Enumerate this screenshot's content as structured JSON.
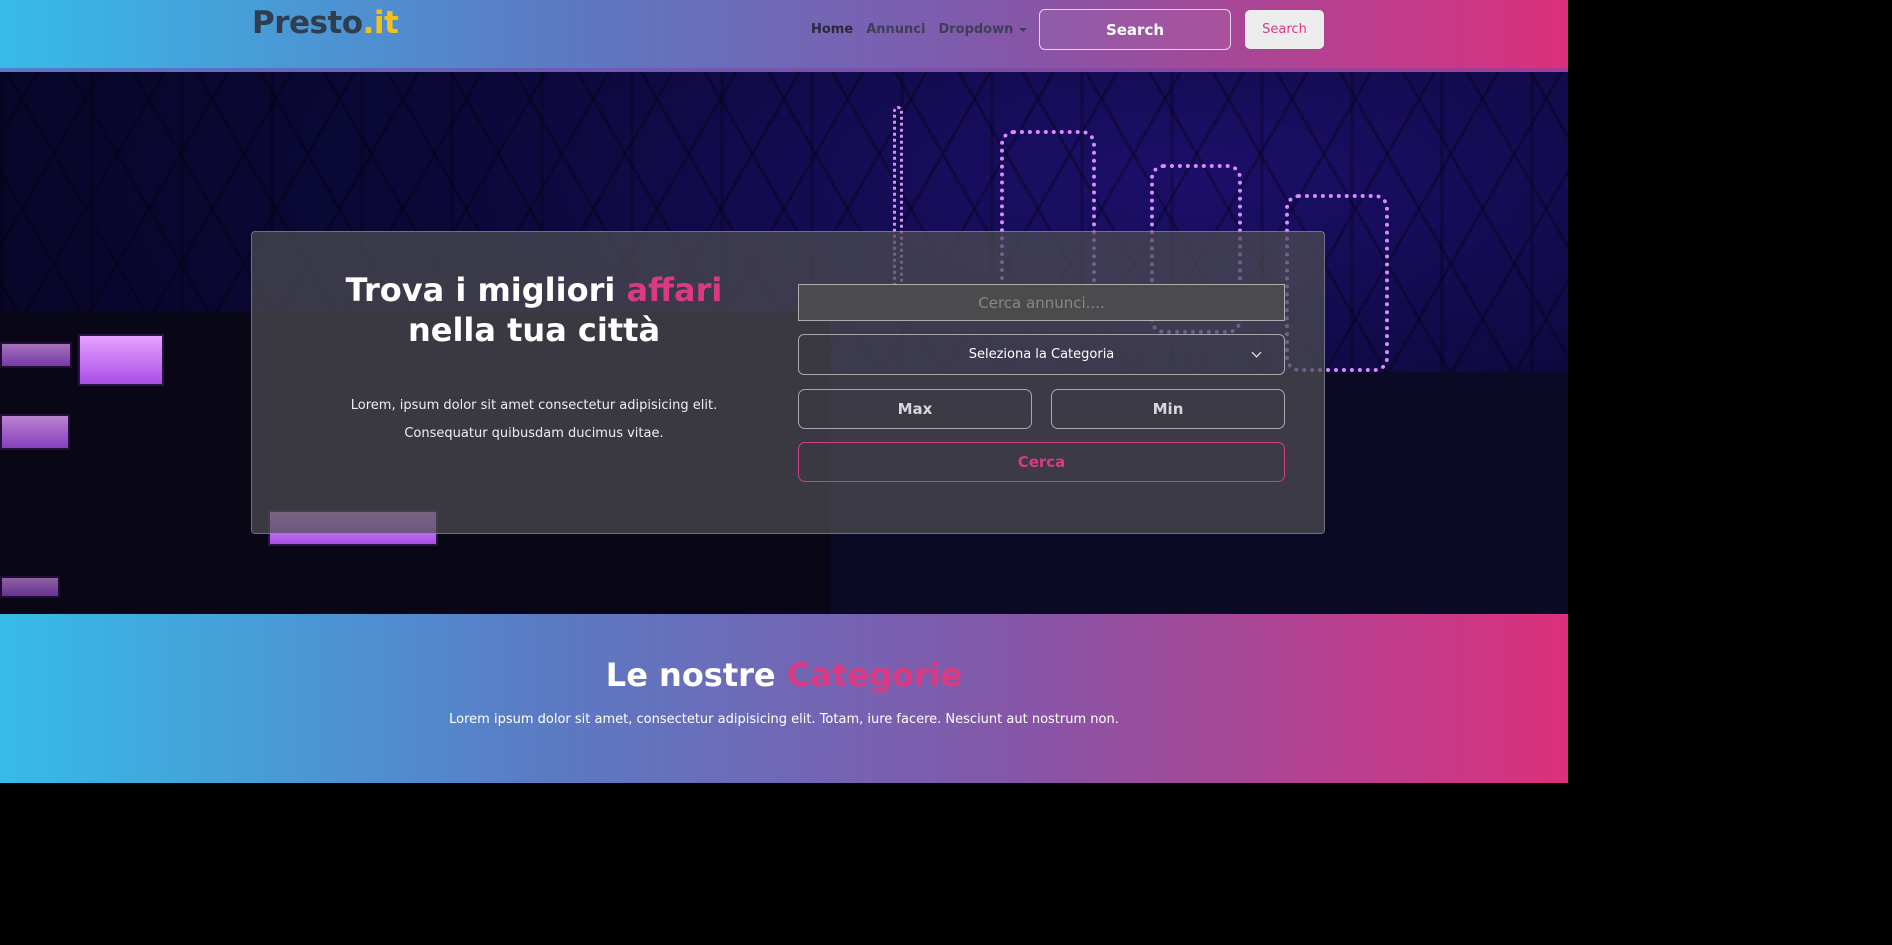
{
  "navbar": {
    "brand_name": "Presto",
    "brand_tld": ".it",
    "links": [
      {
        "label": "Home",
        "active": true
      },
      {
        "label": "Annunci"
      },
      {
        "label": "Dropdown",
        "has_caret": true
      }
    ],
    "search_placeholder": "Search",
    "search_button": "Search"
  },
  "hero": {
    "title_before": "Trova i migliori ",
    "title_highlight": "affari",
    "title_after": " nella tua città",
    "text_line1": "Lorem, ipsum dolor sit amet consectetur adipisicing elit.",
    "text_line2": "Consequatur quibusdam ducimus vitae.",
    "form": {
      "search_placeholder": "Cerca annunci....",
      "category_select": "Seleziona la Categoria",
      "max_placeholder": "Max",
      "min_placeholder": "Min",
      "submit_label": "Cerca"
    }
  },
  "categories_section": {
    "title_before": "Le nostre ",
    "title_highlight": "Categorie",
    "text": "Lorem ipsum dolor sit amet, consectetur adipisicing elit. Totam, iure facere. Nesciunt aut nostrum non."
  },
  "colors": {
    "gradient_start": "#36bbe8",
    "gradient_end": "#dc2f7c",
    "accent_pink": "#d63b86",
    "brand_yellow": "#f2c21b"
  }
}
